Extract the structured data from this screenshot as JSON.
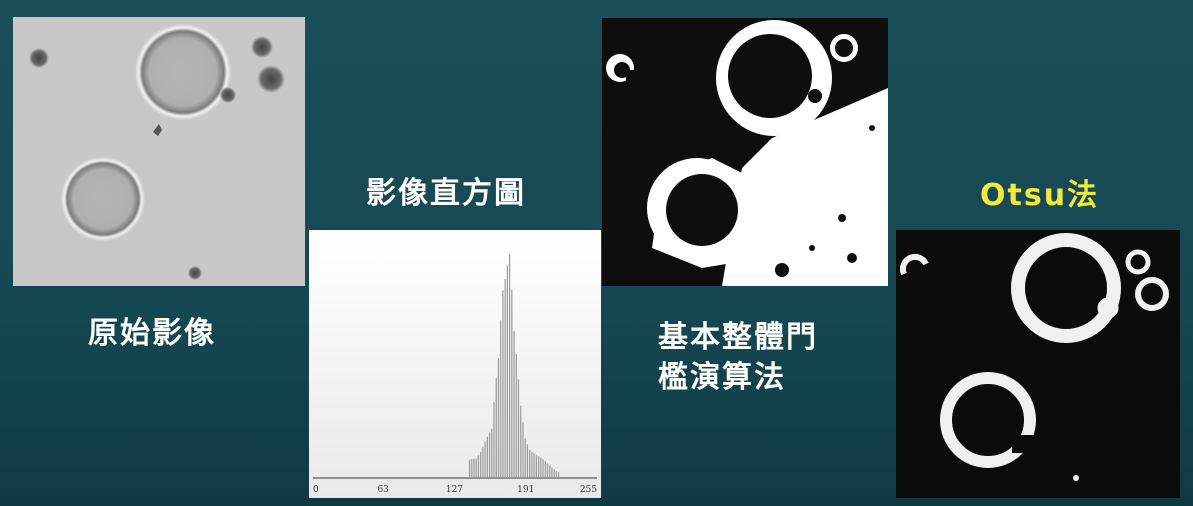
{
  "slide": {
    "background": "#154852",
    "caption_original": "原始影像",
    "caption_histogram": "影像直方圖",
    "caption_global_line1": "基本整體門",
    "caption_global_line2": "檻演算法",
    "caption_otsu": "Otsu法",
    "accent_color": "#f2ea3a"
  },
  "histogram": {
    "ticks": [
      "0",
      "63",
      "127",
      "191",
      "255"
    ]
  },
  "chart_data": {
    "type": "bar",
    "xlim": [
      0,
      255
    ],
    "xticks": [
      0,
      63,
      127,
      191,
      255
    ],
    "peaks_description_values": {
      "x": [
        140,
        150,
        160,
        166,
        170,
        176,
        180,
        186,
        190,
        200,
        210,
        220
      ],
      "y": [
        0.08,
        0.12,
        0.2,
        0.55,
        1.0,
        0.98,
        0.6,
        0.3,
        0.18,
        0.1,
        0.06,
        0.03
      ]
    }
  }
}
